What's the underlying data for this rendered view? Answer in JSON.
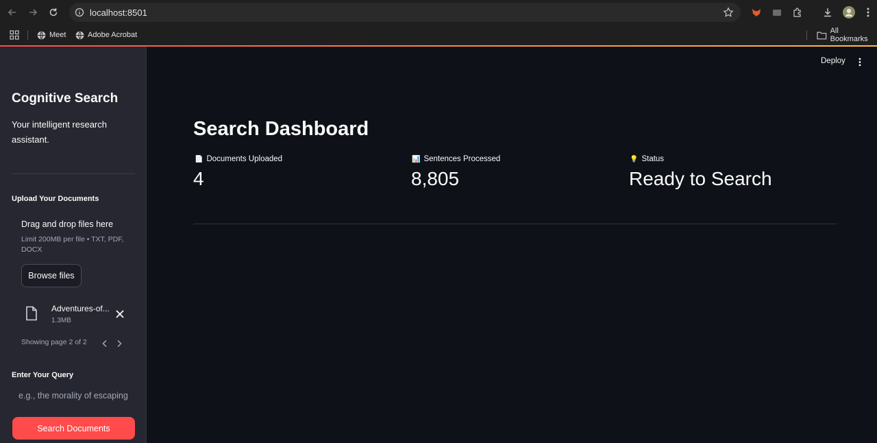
{
  "browser": {
    "url": "localhost:8501",
    "bookmarks": [
      {
        "label": "Meet",
        "icon": "globe-icon"
      },
      {
        "label": "Adobe Acrobat",
        "icon": "globe-icon"
      }
    ],
    "all_bookmarks": "All Bookmarks"
  },
  "sidebar": {
    "title": "Cognitive Search",
    "subtitle": "Your intelligent research assistant.",
    "upload_label": "Upload Your Documents",
    "drop_title": "Drag and drop files here",
    "drop_limit": "Limit 200MB per file • TXT, PDF, DOCX",
    "browse_button": "Browse files",
    "file": {
      "name": "Adventures-of...",
      "size": "1.3MB"
    },
    "paging": "Showing page 2 of 2",
    "query_label": "Enter Your Query",
    "query_placeholder": "e.g., the morality of escaping",
    "query_value": "",
    "search_button": "Search Documents"
  },
  "header": {
    "deploy": "Deploy"
  },
  "main": {
    "title": "Search Dashboard",
    "metrics": [
      {
        "icon": "📄",
        "label": "Documents Uploaded",
        "value": "4"
      },
      {
        "icon": "📊",
        "label": "Sentences Processed",
        "value": "8,805"
      },
      {
        "icon": "💡",
        "label": "Status",
        "value": "Ready to Search"
      }
    ]
  },
  "colors": {
    "background": "#0e1117",
    "sidebar": "#262730",
    "accent": "#ff4b4b",
    "text": "#fafafa"
  }
}
